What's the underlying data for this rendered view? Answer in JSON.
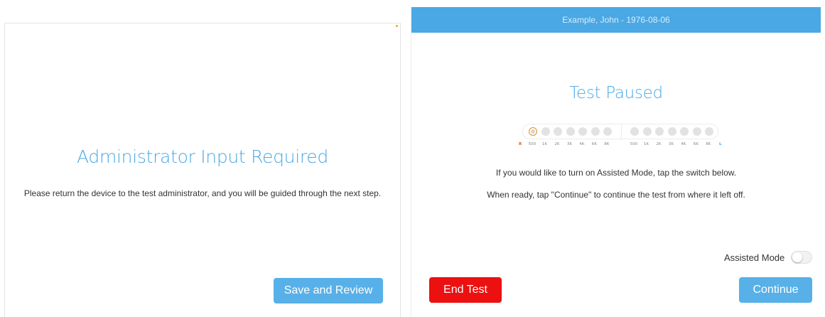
{
  "left_screen": {
    "title": "Administrator Input Required",
    "message": "Please return the device to the test administrator, and you will be guided through the next step.",
    "save_button": "Save and Review"
  },
  "right_screen": {
    "header": "Example, John - 1976-08-06",
    "title": "Test Paused",
    "progress": {
      "right_ear_label": "R",
      "left_ear_label": "L",
      "right_frequencies": [
        "500",
        "1K",
        "2K",
        "3K",
        "4K",
        "6K",
        "8K"
      ],
      "left_frequencies": [
        "500",
        "1K",
        "2K",
        "3K",
        "4K",
        "6K",
        "8K"
      ],
      "current_index": 0
    },
    "instruction_1": "If you would like to turn on Assisted Mode, tap the switch below.",
    "instruction_2": "When ready, tap \"Continue\" to continue the test from where it left off.",
    "assisted_mode_label": "Assisted Mode",
    "assisted_mode_on": false,
    "end_button": "End Test",
    "continue_button": "Continue"
  },
  "colors": {
    "accent": "#4aa8e4",
    "button_blue": "#58b0e8",
    "danger": "#ec1010",
    "current_marker": "#e8901e"
  }
}
